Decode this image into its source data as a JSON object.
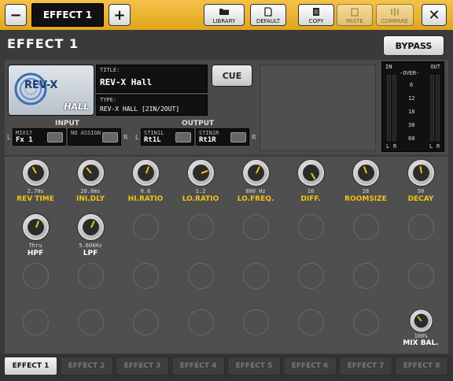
{
  "toolbar": {
    "minus_label": "−",
    "title": "EFFECT 1",
    "plus_label": "+",
    "library_label": "LIBRARY",
    "default_label": "DEFAULT",
    "copy_label": "COPY",
    "paste_label": "PASTE",
    "compare_label": "COMPARE",
    "close_label": "✕"
  },
  "page_title": "EFFECT 1",
  "bypass_label": "BYPASS",
  "cue_label": "CUE",
  "effect": {
    "logo_text": "REV-X",
    "logo_sub": "HALL",
    "title_label": "TITLE:",
    "title_value": "REV-X Hall",
    "type_label": "TYPE:",
    "type_value": "REV-X HALL    [2IN/2OUT]"
  },
  "meter": {
    "in_label": "IN",
    "out_label": "OUT",
    "over_label": "-OVER-",
    "scale": [
      "6",
      "12",
      "18",
      "30",
      "60"
    ],
    "l": "L",
    "r": "R"
  },
  "input": {
    "title": "INPUT",
    "port1_label": "MIX17",
    "port1_value": "Fx 1",
    "port2_label": "NO ASSIGN",
    "port2_value": "",
    "left": "L",
    "right": "R"
  },
  "output": {
    "title": "OUTPUT",
    "port1_label": "STIN1L",
    "port1_value": "Rt1L",
    "port2_label": "STIN1R",
    "port2_value": "Rt1R",
    "left": "L",
    "right": "R"
  },
  "knobs": [
    {
      "value": "2.70s",
      "name": "REV TIME",
      "angle": -30
    },
    {
      "value": "20.0ms",
      "name": "INI.DLY",
      "angle": -40
    },
    {
      "value": "0.6",
      "name": "HI.RATIO",
      "angle": 20
    },
    {
      "value": "1.2",
      "name": "LO.RATIO",
      "angle": 70
    },
    {
      "value": "800 Hz",
      "name": "LO.FREQ.",
      "angle": 25
    },
    {
      "value": "10",
      "name": "DIFF.",
      "angle": 150
    },
    {
      "value": "28",
      "name": "ROOMSIZE",
      "angle": -20
    },
    {
      "value": "50",
      "name": "DECAY",
      "angle": -10
    }
  ],
  "knobs2": [
    {
      "value": "Thru",
      "name": "HPF",
      "angle": 20
    },
    {
      "value": "5.60kHz",
      "name": "LPF",
      "angle": 25
    }
  ],
  "mix": {
    "value": "100%",
    "name": "MIX BAL.",
    "angle": -40
  },
  "tabs": [
    "EFFECT 1",
    "EFFECT 2",
    "EFFECT 3",
    "EFFECT 4",
    "EFFECT 5",
    "EFFECT 6",
    "EFFECT 7",
    "EFFECT 8"
  ]
}
